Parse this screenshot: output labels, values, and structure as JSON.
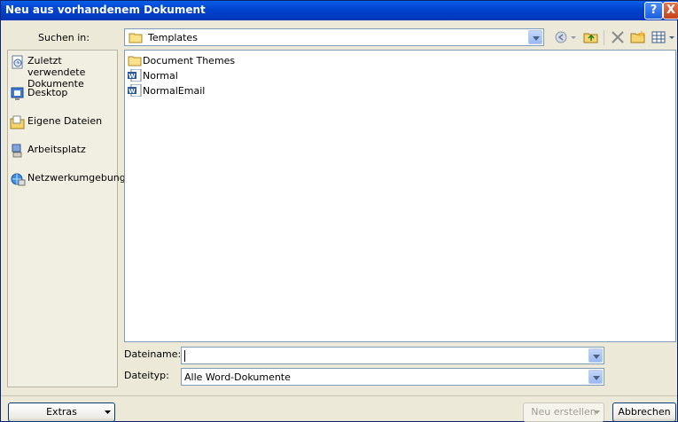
{
  "window": {
    "title": "Neu aus vorhandenem Dokument",
    "help_label": "?",
    "close_label": "X"
  },
  "lookin": {
    "label": "Suchen in:",
    "value": "Templates"
  },
  "places": [
    {
      "label": "Zuletzt verwendete Dokumente",
      "icon": "recent-documents-icon"
    },
    {
      "label": "Desktop",
      "icon": "desktop-icon"
    },
    {
      "label": "Eigene Dateien",
      "icon": "my-documents-icon"
    },
    {
      "label": "Arbeitsplatz",
      "icon": "my-computer-icon"
    },
    {
      "label": "Netzwerkumgebung",
      "icon": "network-places-icon"
    }
  ],
  "files": [
    {
      "name": "Document Themes",
      "icon": "folder-icon"
    },
    {
      "name": "Normal",
      "icon": "word-document-icon"
    },
    {
      "name": "NormalEmail",
      "icon": "word-document-icon"
    }
  ],
  "filename": {
    "label": "Dateiname:",
    "value": ""
  },
  "filetype": {
    "label": "Dateityp:",
    "value": "Alle Word-Dokumente"
  },
  "buttons": {
    "extras": "Extras",
    "create": "Neu erstellen",
    "cancel": "Abbrechen"
  },
  "colors": {
    "titlebar": "#0054e3",
    "dialog": "#ece9d8",
    "border": "#7f9db9"
  }
}
